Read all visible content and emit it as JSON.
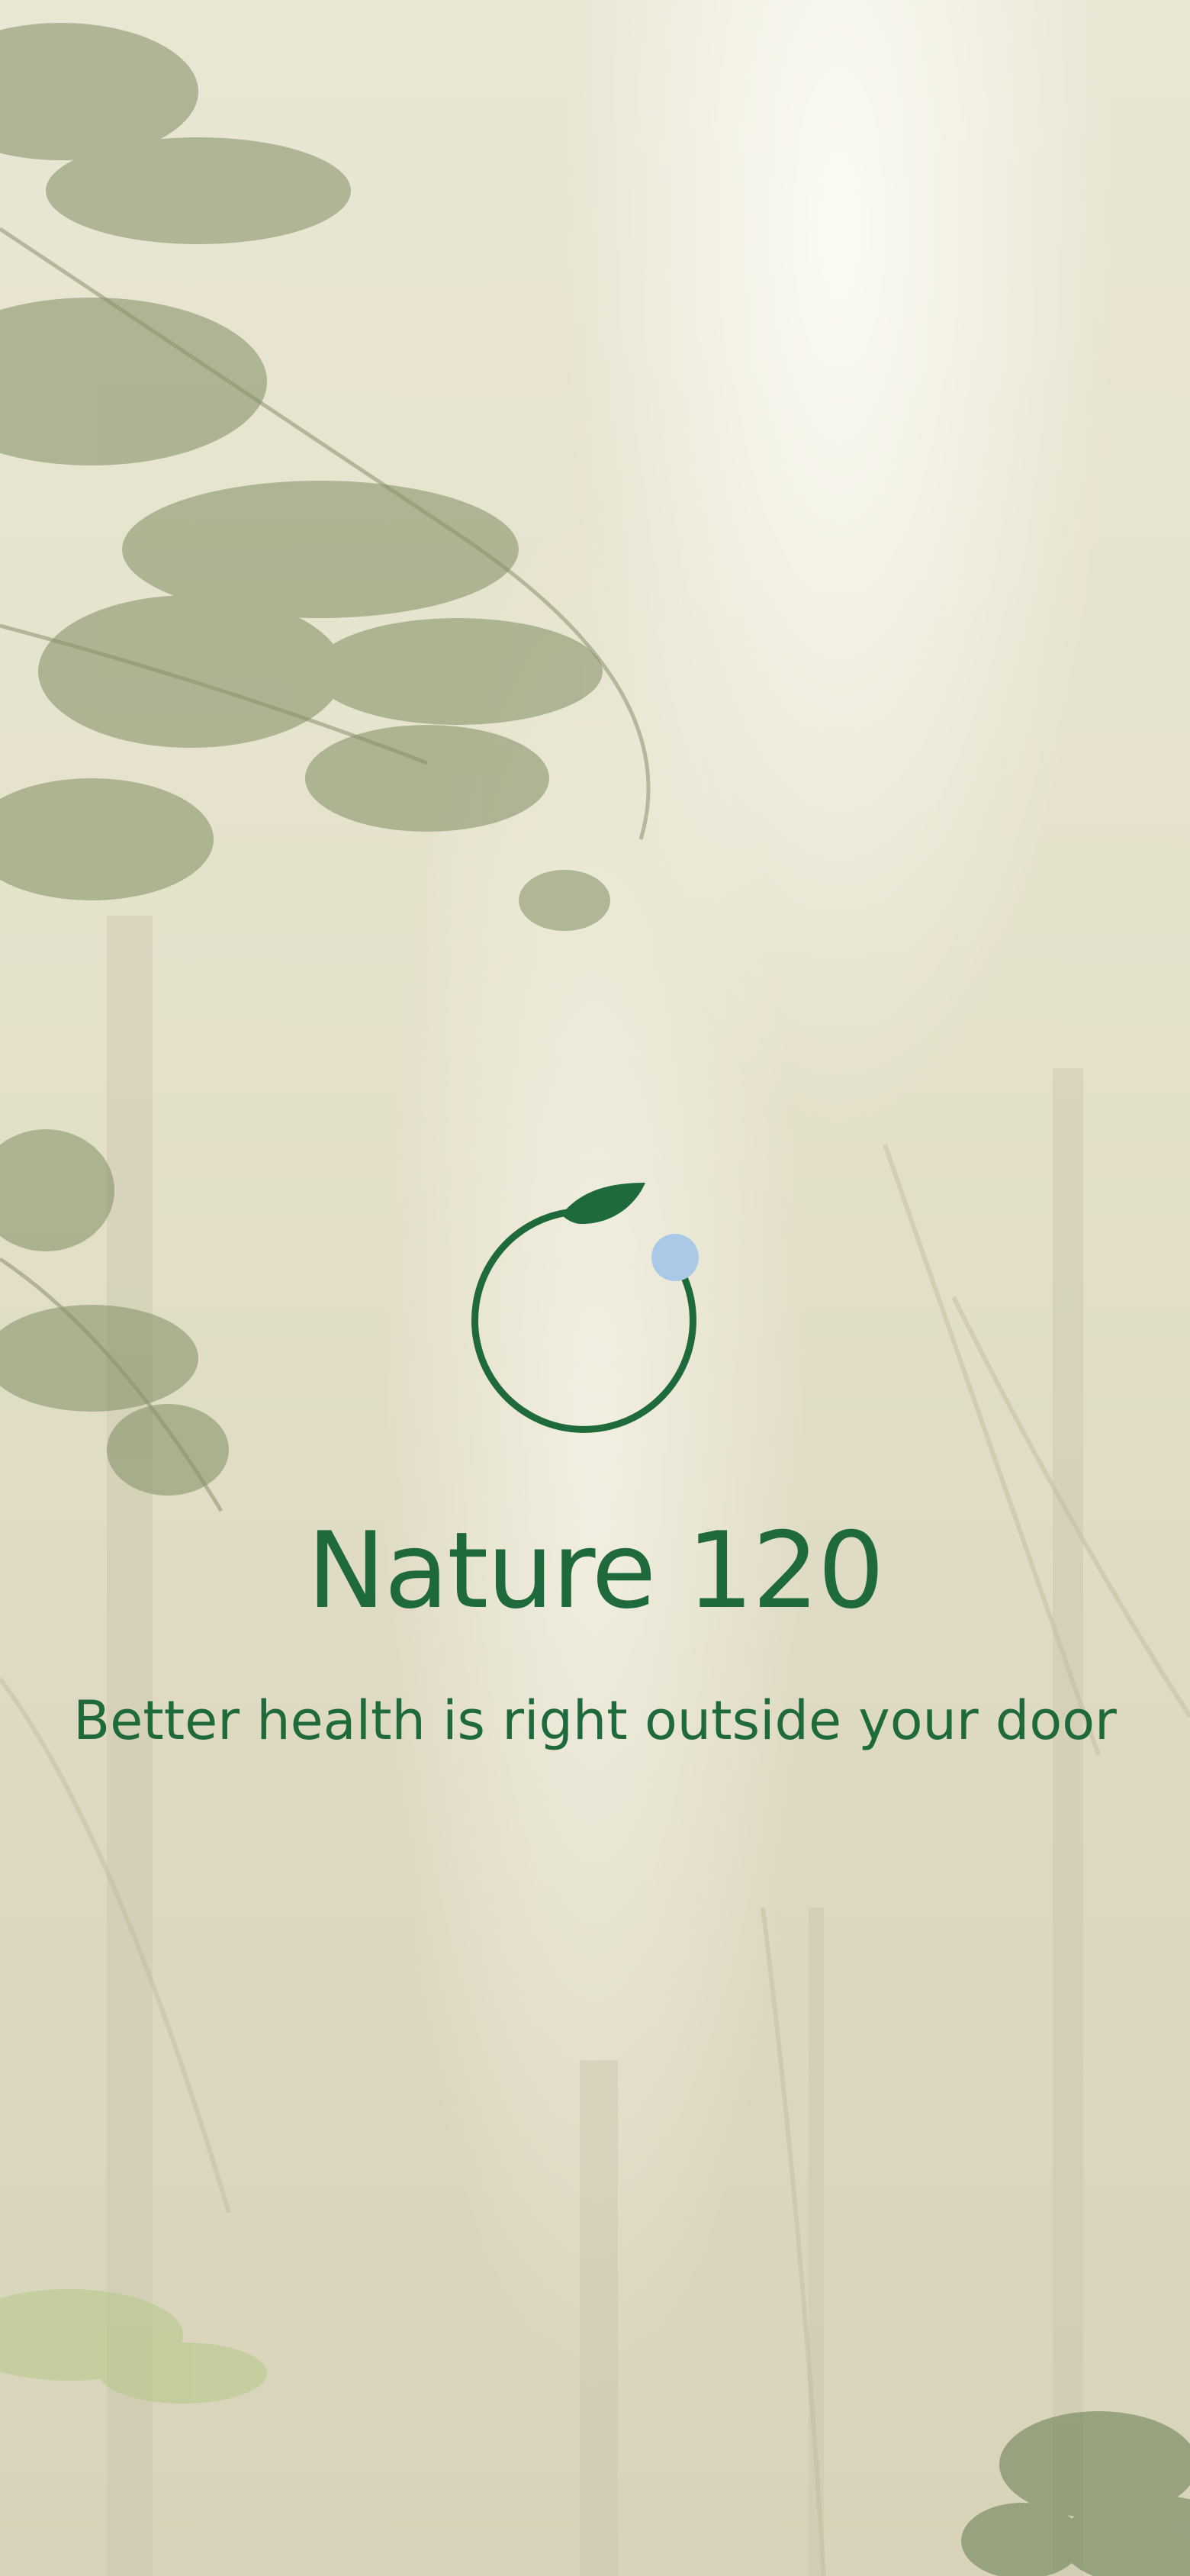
{
  "app": {
    "title": "Nature 120",
    "tagline": "Better health is right outside your door"
  },
  "logo": {
    "icon": "leaf-ring-logo-icon",
    "ring_color": "#1f6a3a",
    "leaf_color": "#1f6a3a",
    "dot_color": "#a9c9e6"
  },
  "background": {
    "description_icon": "misty-forest-background",
    "tone": "#e5e2cc"
  }
}
